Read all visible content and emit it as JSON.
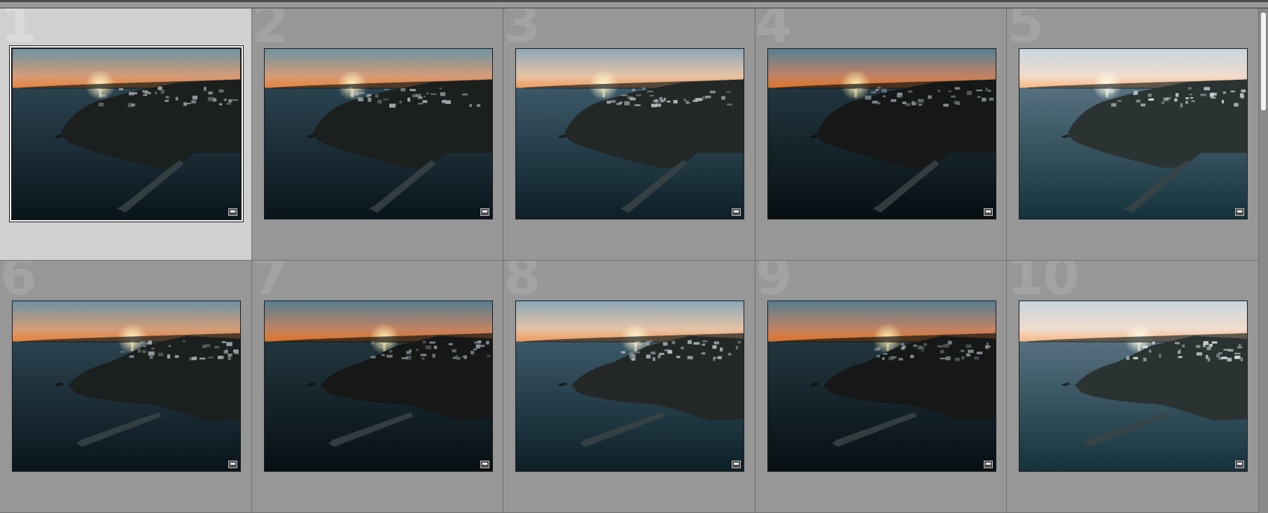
{
  "app": {
    "view": "grid"
  },
  "colors": {
    "grid_bg": "#979797",
    "selected_cell_bg": "#d0d0d0",
    "cell_border": "#707070",
    "index_text": "#a3a3a3"
  },
  "thumbnail": {
    "icon": "metadata-badge-icon"
  },
  "photos": [
    {
      "index": "1",
      "selected": true,
      "framing": "high",
      "tone": "dark"
    },
    {
      "index": "2",
      "selected": false,
      "framing": "high",
      "tone": "dark"
    },
    {
      "index": "3",
      "selected": false,
      "framing": "high",
      "tone": "light"
    },
    {
      "index": "4",
      "selected": false,
      "framing": "high",
      "tone": "darker"
    },
    {
      "index": "5",
      "selected": false,
      "framing": "high",
      "tone": "bright"
    },
    {
      "index": "6",
      "selected": false,
      "framing": "low",
      "tone": "dark"
    },
    {
      "index": "7",
      "selected": false,
      "framing": "low",
      "tone": "darker"
    },
    {
      "index": "8",
      "selected": false,
      "framing": "low",
      "tone": "light"
    },
    {
      "index": "9",
      "selected": false,
      "framing": "low",
      "tone": "darker"
    },
    {
      "index": "10",
      "selected": false,
      "framing": "low",
      "tone": "bright"
    }
  ]
}
